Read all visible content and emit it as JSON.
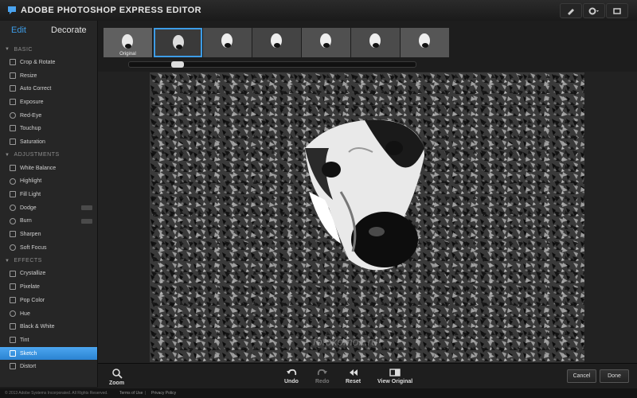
{
  "app": {
    "title": "ADOBE PHOTOSHOP EXPRESS EDITOR"
  },
  "titlebar_icons": [
    "pen-icon",
    "gear-icon",
    "fullscreen-icon"
  ],
  "tabs": {
    "edit": "Edit",
    "decorate": "Decorate"
  },
  "sections": [
    {
      "title": "BASIC",
      "items": [
        "Crop & Rotate",
        "Resize",
        "Auto Correct",
        "Exposure",
        "Red-Eye",
        "Touchup",
        "Saturation"
      ]
    },
    {
      "title": "ADJUSTMENTS",
      "items": [
        "White Balance",
        "Highlight",
        "Fill Light",
        "Dodge",
        "Burn",
        "Sharpen",
        "Soft Focus"
      ]
    },
    {
      "title": "EFFECTS",
      "items": [
        "Crystallize",
        "Pixelate",
        "Pop Color",
        "Hue",
        "Black & White",
        "Tint",
        "Sketch",
        "Distort"
      ]
    }
  ],
  "active_item": "Sketch",
  "thumbnails": {
    "original_label": "Original",
    "count": 7,
    "selected_index": 1
  },
  "slider": {
    "value_fraction": 0.16
  },
  "toolbar": {
    "zoom": "Zoom",
    "undo": "Undo",
    "redo": "Redo",
    "reset": "Reset",
    "view_original": "View Original",
    "cancel": "Cancel",
    "done": "Done"
  },
  "watermark": "fotokomok.ru",
  "footer": {
    "copyright": "© 2013 Adobe Systems Incorporated. All Rights Reserved.",
    "terms": "Terms of Use",
    "privacy": "Privacy Policy"
  },
  "colors": {
    "accent": "#3d9ce6",
    "active_item_bg": "#3b95e0",
    "background": "#1b1b1b"
  }
}
